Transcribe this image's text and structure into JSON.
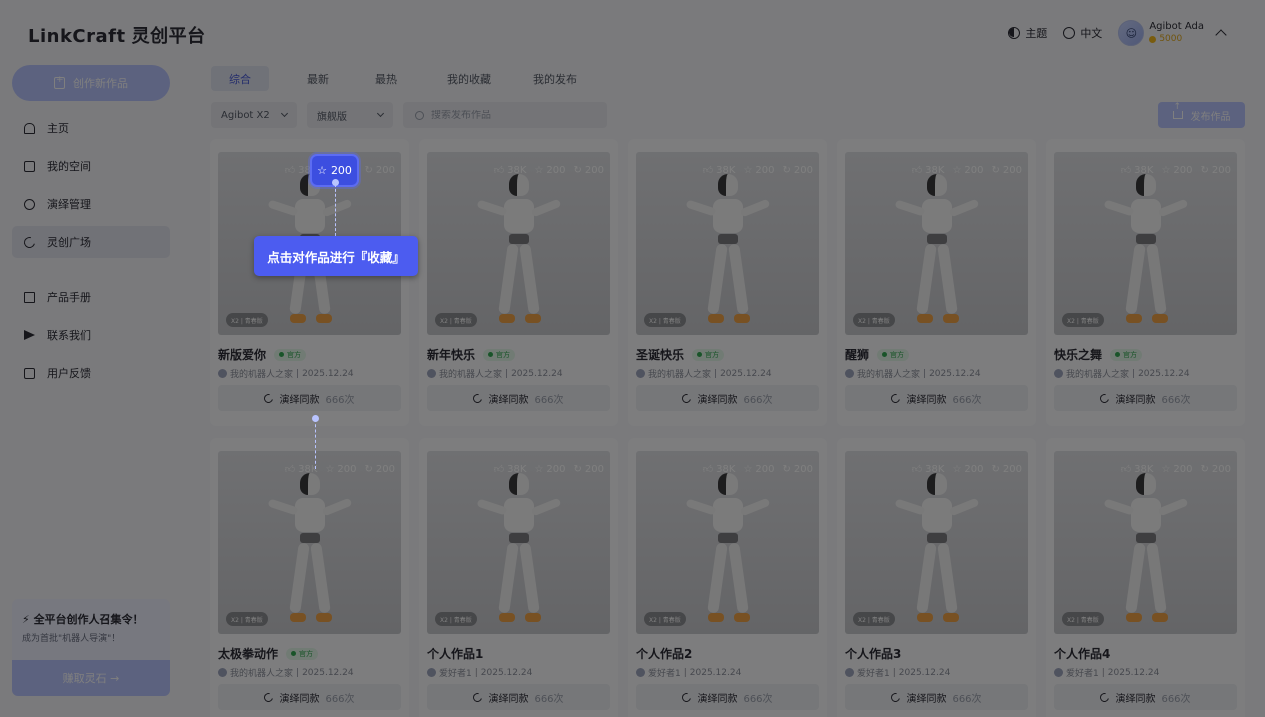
{
  "header": {
    "logo": "LinkCraft",
    "logo_sub": "灵创平台",
    "theme_label": "主题",
    "lang_label": "中文",
    "user_name": "Agibot Ada",
    "user_coins": "5000"
  },
  "sidebar": {
    "create_label": "创作新作品",
    "items": [
      {
        "label": "主页",
        "icon": "home-icon"
      },
      {
        "label": "我的空间",
        "icon": "folder-icon"
      },
      {
        "label": "演绎管理",
        "icon": "triad-icon"
      },
      {
        "label": "灵创广场",
        "icon": "loop-icon"
      },
      {
        "label": "产品手册",
        "icon": "book-icon"
      },
      {
        "label": "联系我们",
        "icon": "send-icon"
      },
      {
        "label": "用户反馈",
        "icon": "chat-icon"
      }
    ],
    "promo": {
      "title": "全平台创作人召集令！",
      "subtitle": "成为首批\"机器人导演\"！",
      "button": "赚取灵石 →"
    }
  },
  "tabs": [
    "综合",
    "最新",
    "最热",
    "我的收藏",
    "我的发布"
  ],
  "filters": {
    "model": "Agibot X2",
    "edition": "旗舰版",
    "search_placeholder": "搜索发布作品",
    "publish_label": "发布作品"
  },
  "cards": [
    {
      "title": "新版爱你",
      "official": true,
      "author": "我的机器人之家",
      "date": "2025.12.24",
      "likes": "38K",
      "stars": "200",
      "shares": "200",
      "badge": "X2 | 青春版",
      "btn": "演绎同款",
      "count": "666次"
    },
    {
      "title": "新年快乐",
      "official": true,
      "author": "我的机器人之家",
      "date": "2025.12.24",
      "likes": "38K",
      "stars": "200",
      "shares": "200",
      "badge": "X2 | 青春版",
      "btn": "演绎同款",
      "count": "666次"
    },
    {
      "title": "圣诞快乐",
      "official": true,
      "author": "我的机器人之家",
      "date": "2025.12.24",
      "likes": "38K",
      "stars": "200",
      "shares": "200",
      "badge": "X2 | 青春版",
      "btn": "演绎同款",
      "count": "666次"
    },
    {
      "title": "醒狮",
      "official": true,
      "author": "我的机器人之家",
      "date": "2025.12.24",
      "likes": "38K",
      "stars": "200",
      "shares": "200",
      "badge": "X2 | 青春版",
      "btn": "演绎同款",
      "count": "666次"
    },
    {
      "title": "快乐之舞",
      "official": true,
      "author": "我的机器人之家",
      "date": "2025.12.24",
      "likes": "38K",
      "stars": "200",
      "shares": "200",
      "badge": "X2 | 青春版",
      "btn": "演绎同款",
      "count": "666次"
    },
    {
      "title": "太极拳动作",
      "official": true,
      "author": "我的机器人之家",
      "date": "2025.12.24",
      "likes": "38K",
      "stars": "200",
      "shares": "200",
      "badge": "X2 | 青春版",
      "btn": "演绎同款",
      "count": "666次"
    },
    {
      "title": "个人作品1",
      "official": false,
      "author": "爱好者1",
      "date": "2025.12.24",
      "likes": "38K",
      "stars": "200",
      "shares": "200",
      "badge": "X2 | 青春版",
      "btn": "演绎同款",
      "count": "666次"
    },
    {
      "title": "个人作品2",
      "official": false,
      "author": "爱好者1",
      "date": "2025.12.24",
      "likes": "38K",
      "stars": "200",
      "shares": "200",
      "badge": "X2 | 青春版",
      "btn": "演绎同款",
      "count": "666次"
    },
    {
      "title": "个人作品3",
      "official": false,
      "author": "爱好者1",
      "date": "2025.12.24",
      "likes": "38K",
      "stars": "200",
      "shares": "200",
      "badge": "X2 | 青春版",
      "btn": "演绎同款",
      "count": "666次"
    },
    {
      "title": "个人作品4",
      "official": false,
      "author": "爱好者1",
      "date": "2025.12.24",
      "likes": "38K",
      "stars": "200",
      "shares": "200",
      "badge": "X2 | 青春版",
      "btn": "演绎同款",
      "count": "666次"
    }
  ],
  "official_label": "官方",
  "tour": {
    "highlight_value": "200",
    "tooltip": "点击对作品进行『收藏』"
  },
  "colors": {
    "accent": "#4c5cf0",
    "accent_light": "#b9c4ff",
    "official_green": "#32a852",
    "overlay": "rgba(0,0,0,0.5)"
  }
}
